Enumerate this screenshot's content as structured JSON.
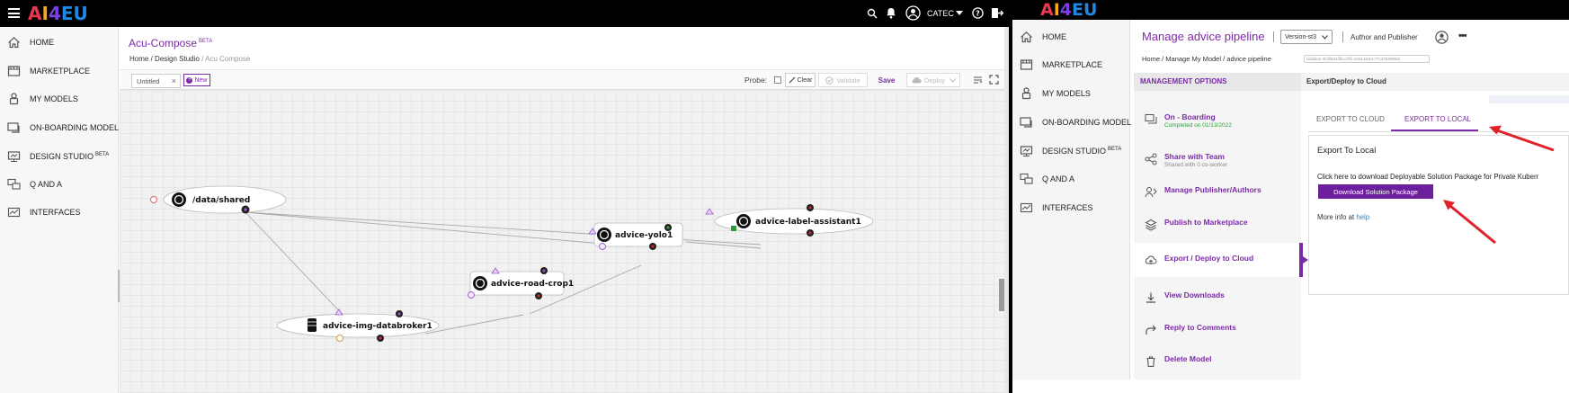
{
  "left": {
    "logo": {
      "a": "A",
      "i": "I",
      "four": "4",
      "eu": "EU"
    },
    "header": {
      "user": "CATEC"
    },
    "sidebar": {
      "items": [
        {
          "label": "HOME",
          "icon": "home-icon"
        },
        {
          "label": "MARKETPLACE",
          "icon": "marketplace-icon"
        },
        {
          "label": "MY MODELS",
          "icon": "models-icon"
        },
        {
          "label": "ON-BOARDING MODEL",
          "icon": "onboarding-icon"
        },
        {
          "label": "DESIGN STUDIO",
          "sup": "BETA",
          "icon": "design-studio-icon"
        },
        {
          "label": "Q AND A",
          "icon": "qa-icon"
        },
        {
          "label": "INTERFACES",
          "icon": "interfaces-icon"
        }
      ]
    },
    "title": "Acu-Compose",
    "title_sup": "BETA",
    "breadcrumb": {
      "home": "Home",
      "sep1": "/",
      "studio": "Design Studio",
      "sep2": "/",
      "current": "Acu Compose"
    },
    "toolbar": {
      "tab": "Untitled",
      "tab_close": "×",
      "new": "New",
      "probe": "Probe:",
      "clear": "Clear",
      "validate": "Validate",
      "save": "Save",
      "deploy": "Deploy"
    },
    "nodes": {
      "shared": "/data/shared",
      "label_assistant": "advice-label-assistant1",
      "yolo": "advice-yolo1",
      "road_crop": "advice-road-crop1",
      "databroker": "advice-img-databroker1"
    }
  },
  "right": {
    "logo": {
      "a": "A",
      "i": "I",
      "four": "4",
      "eu": "EU"
    },
    "sidebar": {
      "items": [
        {
          "label": "HOME",
          "icon": "home-icon"
        },
        {
          "label": "MARKETPLACE",
          "icon": "marketplace-icon"
        },
        {
          "label": "MY MODELS",
          "icon": "models-icon"
        },
        {
          "label": "ON-BOARDING MODEL",
          "icon": "onboarding-icon"
        },
        {
          "label": "DESIGN STUDIO",
          "sup": "BETA",
          "icon": "design-studio-icon"
        },
        {
          "label": "Q AND A",
          "icon": "qa-icon"
        },
        {
          "label": "INTERFACES",
          "icon": "interfaces-icon"
        }
      ]
    },
    "title": "Manage advice pipeline",
    "version": "Version-st3",
    "author_label": "Author and Publisher",
    "breadcrumb": {
      "home": "Home",
      "sep1": "/",
      "manage": "Manage My Model",
      "sep2": "/",
      "current": "advice pipeline"
    },
    "solution_id": "Solution ID:9f6d1f3b-e7fb-4163-be43-77c378af9e52",
    "management_header": "MANAGEMENT OPTIONS",
    "management_items": [
      {
        "label": "On - Boarding",
        "sub": "Completed on 01/13/2022",
        "icon": "onboarding-icon"
      },
      {
        "label": "Share with Team",
        "sub": "Shared with 0 co-worker",
        "icon": "share-icon"
      },
      {
        "label": "Manage Publisher/Authors",
        "sub": "",
        "icon": "publisher-icon"
      },
      {
        "label": "Publish to Marketplace",
        "sub": "",
        "icon": "layers-icon"
      },
      {
        "label": "Export / Deploy to Cloud",
        "sub": "",
        "icon": "cloud-upload-icon"
      },
      {
        "label": "View Downloads",
        "sub": "",
        "icon": "download-icon"
      },
      {
        "label": "Reply to Comments",
        "sub": "",
        "icon": "reply-icon"
      },
      {
        "label": "Delete Model",
        "sub": "",
        "icon": "trash-icon"
      }
    ],
    "section_title": "Export/Deploy to Cloud",
    "tabs": {
      "cloud": "EXPORT TO CLOUD",
      "local": "EXPORT TO LOCAL"
    },
    "export_title": "Export To Local",
    "export_text": "Click here to download Deployable Solution Package for Private Kuberr",
    "download_button": "Download Solution Package",
    "more_info": "More info at",
    "help_link": "help",
    "colors": {
      "accent": "#7b2aa8",
      "arrow": "#e0202a",
      "green": "#2e9e3a"
    }
  }
}
